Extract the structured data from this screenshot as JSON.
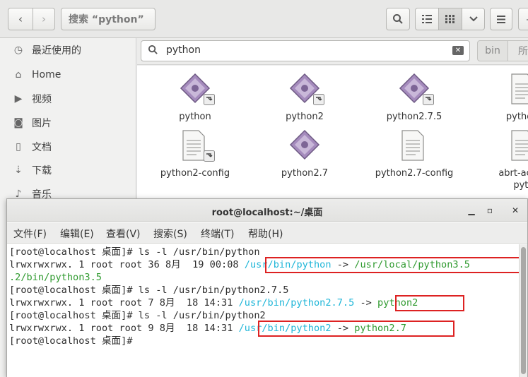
{
  "file_manager": {
    "search_path_label": "搜索 “python”",
    "search_value": "python",
    "chip_bin": "bin",
    "chip_next": "所",
    "sidebar": [
      {
        "icon": "clock-icon",
        "glyph": "◷",
        "label": "最近使用的"
      },
      {
        "icon": "home-icon",
        "glyph": "⌂",
        "label": "Home"
      },
      {
        "icon": "video-icon",
        "glyph": "▶",
        "label": "视频"
      },
      {
        "icon": "camera-icon",
        "glyph": "◙",
        "label": "图片"
      },
      {
        "icon": "document-icon",
        "glyph": "▯",
        "label": "文档"
      },
      {
        "icon": "download-icon",
        "glyph": "⇣",
        "label": "下载"
      },
      {
        "icon": "music-icon",
        "glyph": "♪",
        "label": "音乐"
      }
    ],
    "files": [
      {
        "name": "python",
        "kind": "exec-link"
      },
      {
        "name": "python2",
        "kind": "exec-link"
      },
      {
        "name": "python2.7.5",
        "kind": "exec-link"
      },
      {
        "name": "python-",
        "kind": "doc"
      },
      {
        "name": "python2-config",
        "kind": "doc-link"
      },
      {
        "name": "python2.7",
        "kind": "exec"
      },
      {
        "name": "python2.7-config",
        "kind": "doc"
      },
      {
        "name": "abrt-action",
        "name2": "pyth",
        "kind": "doc"
      }
    ]
  },
  "terminal": {
    "title": "root@localhost:~/桌面",
    "menu": [
      "文件(F)",
      "编辑(E)",
      "查看(V)",
      "搜索(S)",
      "终端(T)",
      "帮助(H)"
    ],
    "lines": {
      "l1": "[root@localhost 桌面]# ls -l /usr/bin/python",
      "l2_prefix": "lrwxrwxrwx. 1 root root 36 8月  19 00:08 ",
      "l2_src": "/usr/bin/python",
      "l2_arrow": " -> ",
      "l2_dst": "/usr/local/python3.5",
      "l3": ".2/bin/python3.5",
      "l4": "[root@localhost 桌面]# ls -l /usr/bin/python2.7.5",
      "l5_prefix": "lrwxrwxrwx. 1 root root 7 8月  18 14:31 ",
      "l5_src": "/usr/bin/python2.7.5",
      "l5_arrow": " -> ",
      "l5_dst": "python2",
      "l6": "[root@localhost 桌面]# ls -l /usr/bin/python2",
      "l7_prefix": "lrwxrwxrwx. 1 root root 9 8月  18 14:31 ",
      "l7_src": "/usr/bin/python2",
      "l7_arrow": " -> ",
      "l7_dst": "python2.7",
      "l8": "[root@localhost 桌面]# "
    }
  },
  "colors": {
    "link_cyan": "#1fb6d8",
    "target_green": "#2f9a2f",
    "highlight_red": "#dd2222"
  }
}
